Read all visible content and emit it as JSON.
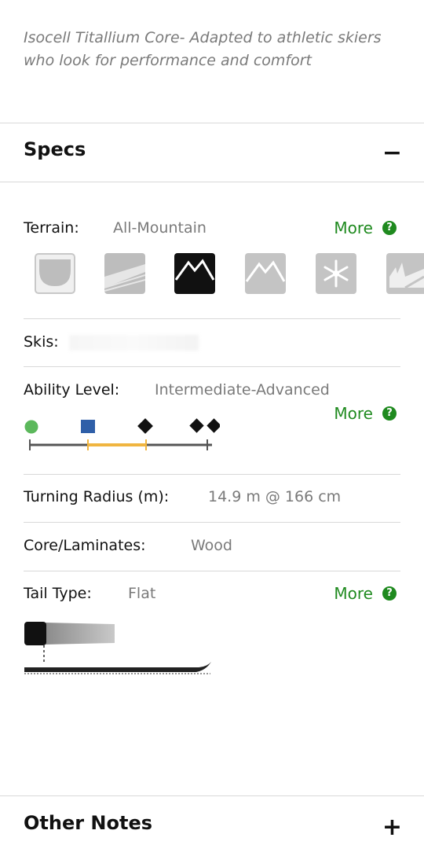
{
  "intro": {
    "text": "Isocell Titallium Core- Adapted to athletic skiers who look for performance and comfort"
  },
  "specs": {
    "title": "Specs",
    "toggle": "−",
    "terrain": {
      "label": "Terrain:",
      "value": "All-Mountain",
      "more": "More",
      "help": "?",
      "icons": [
        {
          "name": "halfpipe-icon",
          "selected": false
        },
        {
          "name": "groomer-icon",
          "selected": false
        },
        {
          "name": "all-mountain-icon",
          "selected": true
        },
        {
          "name": "big-mountain-icon",
          "selected": false
        },
        {
          "name": "powder-snowflake-icon",
          "selected": false
        },
        {
          "name": "backcountry-icon",
          "selected": false
        }
      ]
    },
    "skis": {
      "label": "Skis:"
    },
    "ability": {
      "label": "Ability Level:",
      "value": "Intermediate-Advanced",
      "more": "More",
      "help": "?",
      "levels": [
        "green-circle",
        "blue-square",
        "black-diamond",
        "double-black-diamond"
      ],
      "range_start_level": 1,
      "range_end_level": 2,
      "colors": {
        "green": "#5cb85c",
        "blue": "#2f5fa8",
        "black": "#111111",
        "range": "#f0b540",
        "track": "#555555"
      }
    },
    "turning_radius": {
      "label": "Turning Radius (m):",
      "value": "14.9 m @ 166 cm"
    },
    "core": {
      "label": "Core/Laminates:",
      "value": "Wood"
    },
    "tail": {
      "label": "Tail Type:",
      "value": "Flat",
      "more": "More",
      "help": "?"
    }
  },
  "other_notes": {
    "title": "Other Notes",
    "toggle": "+"
  },
  "colors": {
    "accent_green": "#1f8a1f",
    "muted_text": "#7a7a7a",
    "divider": "#d9d9d9"
  }
}
